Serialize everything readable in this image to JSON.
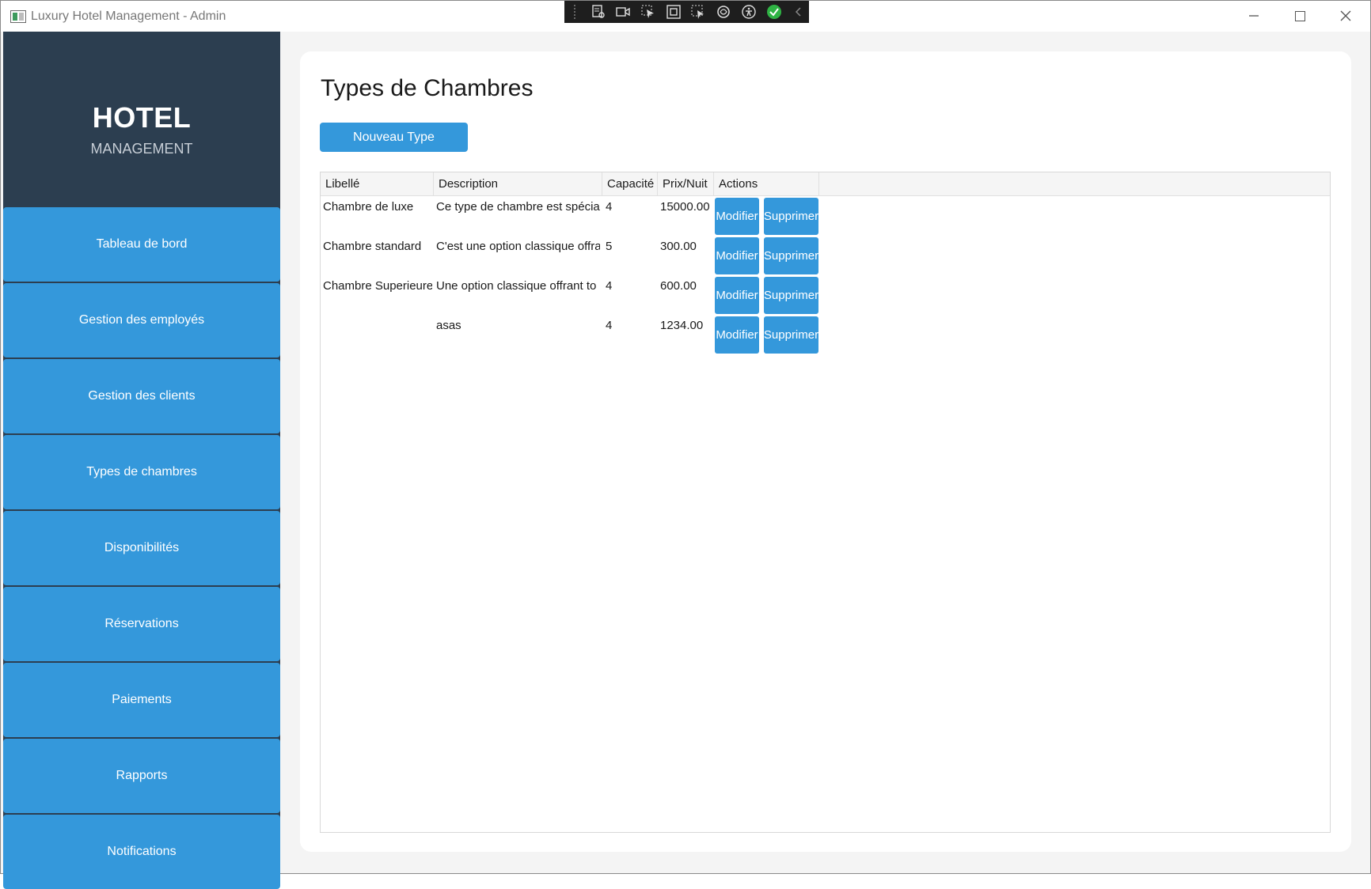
{
  "window": {
    "title": "Luxury Hotel Management - Admin"
  },
  "devbar": {
    "icons": [
      "live-tree-icon",
      "record-icon",
      "select-element-icon",
      "display-layout-icon",
      "track-focus-icon",
      "hot-reload-icon",
      "accessibility-icon",
      "checkmark-icon",
      "collapse-icon"
    ]
  },
  "sidebar": {
    "brand_title": "HOTEL",
    "brand_subtitle": "MANAGEMENT",
    "items": [
      {
        "label": "Tableau de bord"
      },
      {
        "label": "Gestion des employés"
      },
      {
        "label": "Gestion des clients"
      },
      {
        "label": "Types de chambres"
      },
      {
        "label": "Disponibilités"
      },
      {
        "label": "Réservations"
      },
      {
        "label": "Paiements"
      },
      {
        "label": "Rapports"
      },
      {
        "label": "Notifications"
      }
    ]
  },
  "main": {
    "title": "Types de Chambres",
    "new_button": "Nouveau Type",
    "table": {
      "headers": [
        "Libellé",
        "Description",
        "Capacité",
        "Prix/Nuit",
        "Actions"
      ],
      "rows": [
        {
          "libelle": "Chambre de luxe",
          "description": "Ce type de chambre est spécial",
          "capacite": "4",
          "prix": "15000.00",
          "modify": "Modifier",
          "delete": "Supprimer"
        },
        {
          "libelle": "Chambre standard",
          "description": "C'est une option classique offra",
          "capacite": "5",
          "prix": "300.00",
          "modify": "Modifier",
          "delete": "Supprimer"
        },
        {
          "libelle": "Chambre Superieure",
          "description": "Une option classique offrant to",
          "capacite": "4",
          "prix": "600.00",
          "modify": "Modifier",
          "delete": "Supprimer"
        },
        {
          "libelle": "",
          "description": "asas",
          "capacite": "4",
          "prix": "1234.00",
          "modify": "Modifier",
          "delete": "Supprimer"
        }
      ]
    }
  },
  "colors": {
    "sidebar_bg": "#2c3e50",
    "accent": "#3498db",
    "panel_bg": "#ffffff",
    "window_bg": "#f4f4f4"
  }
}
